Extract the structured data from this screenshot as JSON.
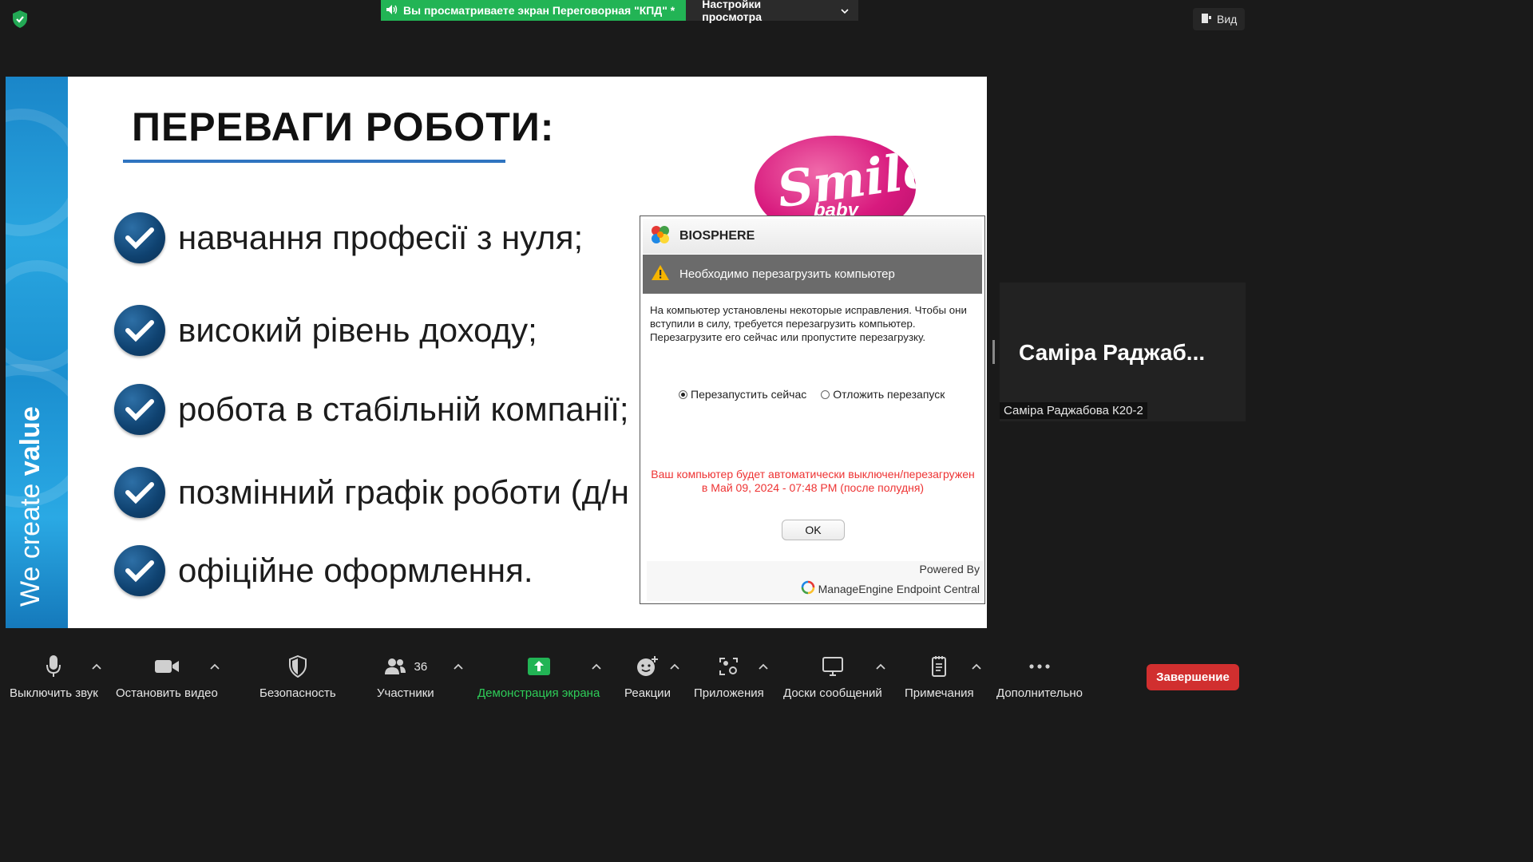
{
  "top_bar": {
    "share_notice": "Вы просматриваете экран Переговорная \"КПД\" *",
    "view_options_label": "Настройки просмотра",
    "view_label": "Вид"
  },
  "slide": {
    "strip_text_light": "We create ",
    "strip_text_bold": "value",
    "title": "ПЕРЕВАГИ РОБОТИ:",
    "bullets": [
      " навчання професії з нуля;",
      "високий рівень доходу;",
      "робота в стабільній компанії;",
      "позмінний графік роботи (д/н",
      "офіційне оформлення."
    ],
    "logo_text": "Smile",
    "logo_subtext": "baby"
  },
  "dialog": {
    "app_name": "BIOSPHERE",
    "header": "Необходимо перезагрузить компьютер",
    "message": "На компьютер установлены некоторые исправления. Чтобы они вступили в силу, требуется перезагрузить компьютер. Перезагрузите его сейчас или пропустите перезагрузку.",
    "option_now": "Перезапустить сейчас",
    "option_later": "Отложить перезапуск",
    "warning": "Ваш компьютер будет автоматически выключен/перезагружен в Май 09, 2024 - 07:48 PM (после полудня)",
    "ok_label": "OK",
    "powered_by": "Powered By",
    "vendor": "ManageEngine Endpoint Central"
  },
  "participant": {
    "display_name": "Саміра  Раджаб...",
    "name_label": "Саміра Раджабова К20-2"
  },
  "toolbar": {
    "mute": "Выключить звук",
    "video": "Остановить видео",
    "security": "Безопасность",
    "participants": "Участники",
    "participants_count": "36",
    "share": "Демонстрация экрана",
    "reactions": "Реакции",
    "apps": "Приложения",
    "whiteboards": "Доски сообщений",
    "notes": "Примечания",
    "more": "Дополнительно",
    "end": "Завершение"
  },
  "colors": {
    "share_green": "#22b455",
    "share_label_green": "#2ecc58",
    "end_red": "#d12f2f",
    "warning_red": "#e33333",
    "slide_underline": "#2f74c0"
  }
}
